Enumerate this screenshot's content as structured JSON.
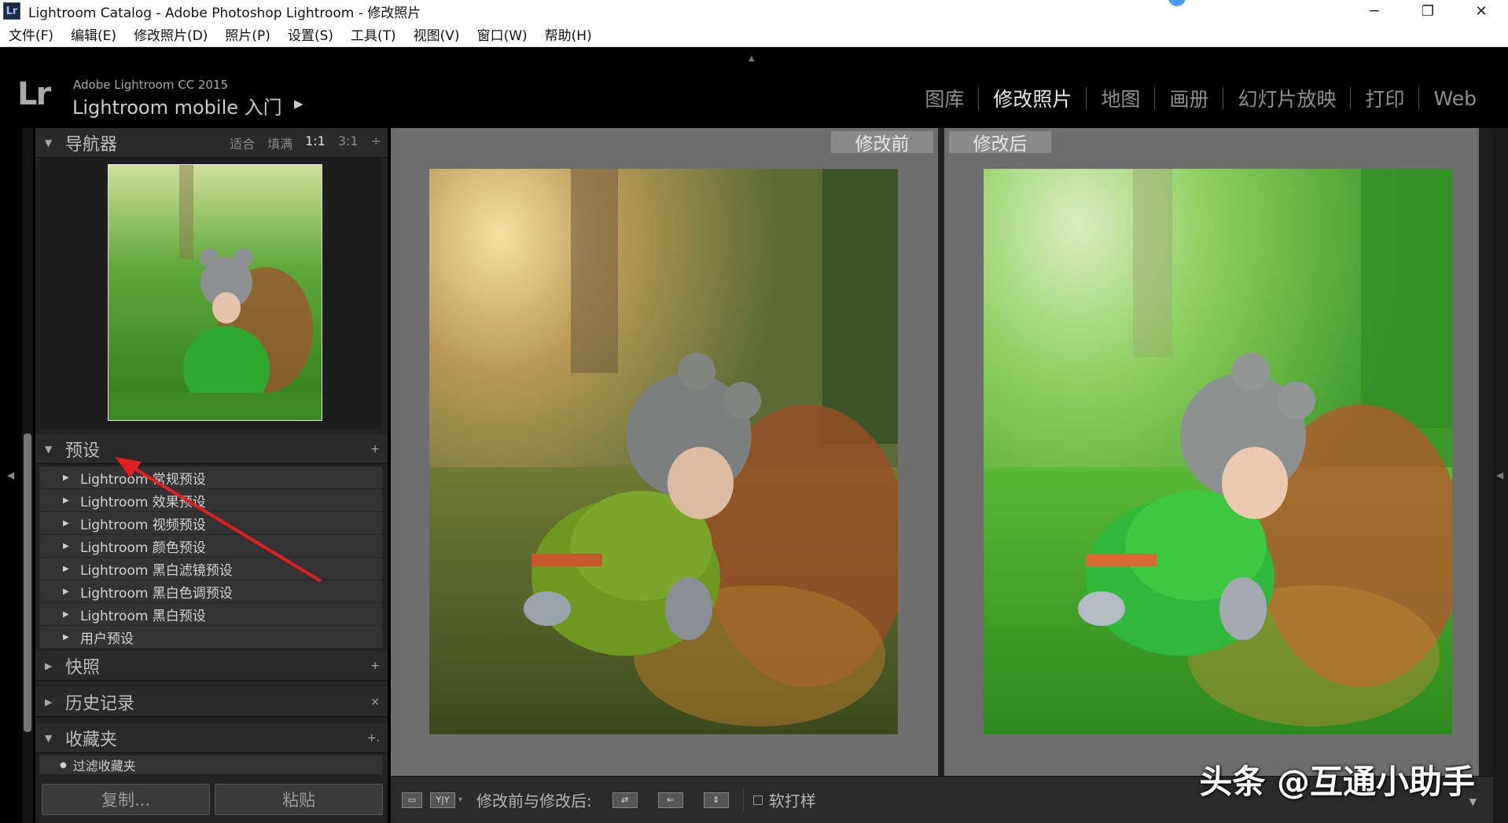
{
  "window": {
    "app_icon": "Lr",
    "title": "Lightroom Catalog - Adobe Photoshop Lightroom - 修改照片",
    "controls": {
      "minimize": "─",
      "maximize": "❐",
      "close": "✕"
    }
  },
  "menu": [
    "文件(F)",
    "编辑(E)",
    "修改照片(D)",
    "照片(P)",
    "设置(S)",
    "工具(T)",
    "视图(V)",
    "窗口(W)",
    "帮助(H)"
  ],
  "identity": {
    "logo": "Lr",
    "small": "Adobe Lightroom CC 2015",
    "big": "Lightroom mobile 入门",
    "arrow": "▶"
  },
  "modules": [
    "图库",
    "修改照片",
    "地图",
    "画册",
    "幻灯片放映",
    "打印",
    "Web"
  ],
  "navigator": {
    "title": "导航器",
    "options": [
      "适合",
      "填满",
      "1:1",
      "3:1"
    ],
    "selected": "1:1",
    "more": "÷"
  },
  "presets": {
    "title": "预设",
    "add": "+",
    "items": [
      "Lightroom 常规预设",
      "Lightroom 效果预设",
      "Lightroom 视频预设",
      "Lightroom 颜色预设",
      "Lightroom 黑白滤镜预设",
      "Lightroom 黑白色调预设",
      "Lightroom 黑白预设",
      "用户预设"
    ]
  },
  "snapshots": {
    "title": "快照",
    "add": "+"
  },
  "history": {
    "title": "历史记录",
    "clear": "×"
  },
  "collections": {
    "title": "收藏夹",
    "add": "+.",
    "first_item": "过滤收藏夹"
  },
  "left_buttons": {
    "copy": "复制...",
    "paste": "粘贴"
  },
  "view": {
    "before_label": "修改前",
    "after_label": "修改后"
  },
  "toolbar": {
    "view_mode_icon": "▭",
    "yy_icon": "Y|Y",
    "before_after_label": "修改前与修改后:",
    "swap_icon": "⇄",
    "copy_icon": "⇐",
    "copy_alt_icon": "⇕",
    "soft_proof": "软打样"
  },
  "watermark": "头条 @互通小助手",
  "colors": {
    "accent_red": "#e02020",
    "panel_bg": "#232323",
    "pane_bg": "#6e6e6e"
  }
}
